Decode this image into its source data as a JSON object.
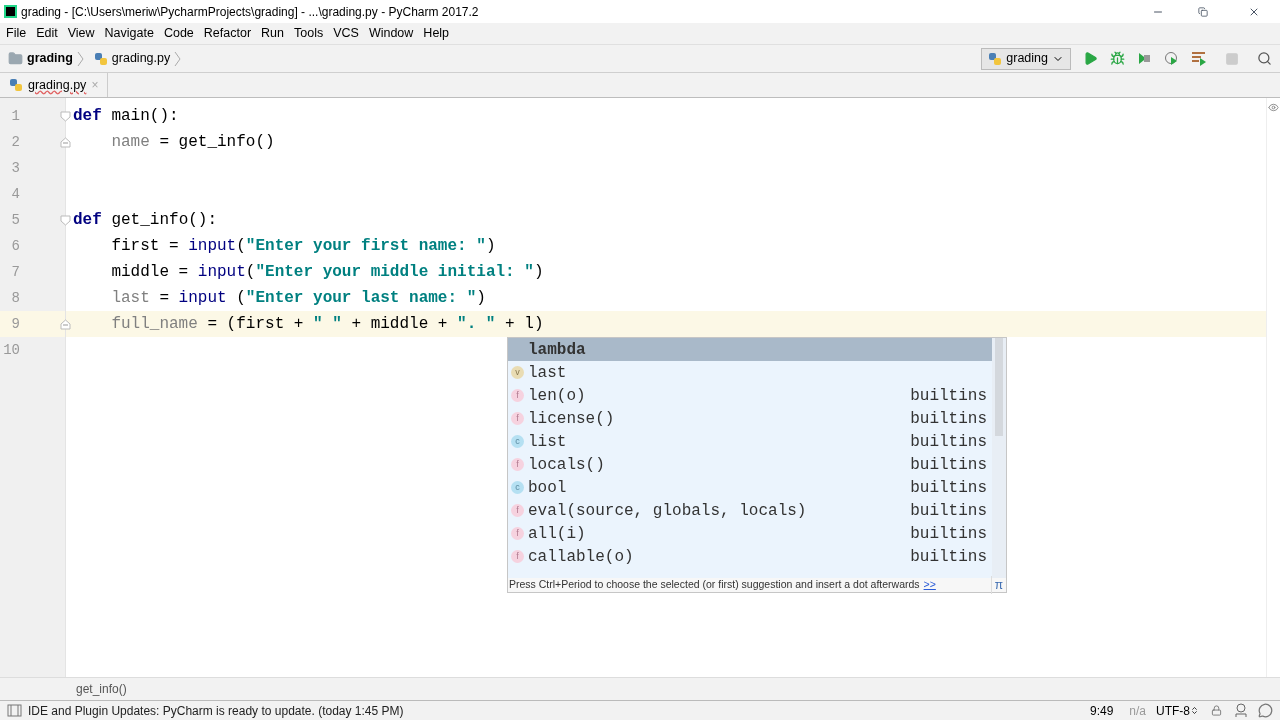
{
  "window": {
    "title": "grading - [C:\\Users\\meriw\\PycharmProjects\\grading] - ...\\grading.py - PyCharm 2017.2"
  },
  "menu": [
    "File",
    "Edit",
    "View",
    "Navigate",
    "Code",
    "Refactor",
    "Run",
    "Tools",
    "VCS",
    "Window",
    "Help"
  ],
  "breadcrumbs": [
    {
      "label": "grading",
      "kind": "folder"
    },
    {
      "label": "grading.py",
      "kind": "file"
    }
  ],
  "run_config": {
    "label": "grading"
  },
  "tabs": [
    {
      "label": "grading.py",
      "selected": true,
      "close": "×"
    }
  ],
  "editor": {
    "lines": [
      {
        "number": "1",
        "fold_start": true,
        "fold_end": false,
        "indent": false,
        "current": false,
        "tokens": [
          {
            "kind": "kw",
            "text": "def"
          },
          {
            "kind": "plain",
            "text": " main():"
          }
        ]
      },
      {
        "number": "2",
        "fold_start": false,
        "fold_end": true,
        "indent": true,
        "current": false,
        "tokens": [
          {
            "kind": "var",
            "text": "name"
          },
          {
            "kind": "plain",
            "text": " = get_info()"
          }
        ]
      },
      {
        "number": "3",
        "fold_start": false,
        "fold_end": false,
        "indent": false,
        "current": false
      },
      {
        "number": "4",
        "fold_start": false,
        "fold_end": false,
        "indent": false,
        "current": false
      },
      {
        "number": "5",
        "fold_start": true,
        "fold_end": false,
        "indent": false,
        "current": false,
        "tokens": [
          {
            "kind": "kw",
            "text": "def"
          },
          {
            "kind": "plain",
            "text": " get_info():"
          }
        ]
      },
      {
        "number": "6",
        "fold_start": false,
        "fold_end": false,
        "indent": true,
        "current": false,
        "tokens": [
          {
            "kind": "plain",
            "text": "first = "
          },
          {
            "kind": "builtin",
            "text": "input"
          },
          {
            "kind": "plain",
            "text": "("
          },
          {
            "kind": "str",
            "text": "\"Enter your first name: \""
          },
          {
            "kind": "plain",
            "text": ")"
          }
        ]
      },
      {
        "number": "7",
        "fold_start": false,
        "fold_end": false,
        "indent": true,
        "current": false,
        "tokens": [
          {
            "kind": "plain",
            "text": "middle = "
          },
          {
            "kind": "builtin",
            "text": "input"
          },
          {
            "kind": "plain",
            "text": "("
          },
          {
            "kind": "str",
            "text": "\"Enter your middle initial: \""
          },
          {
            "kind": "plain",
            "text": ")"
          }
        ]
      },
      {
        "number": "8",
        "fold_start": false,
        "fold_end": false,
        "indent": true,
        "current": false,
        "tokens": [
          {
            "kind": "var",
            "text": "last"
          },
          {
            "kind": "plain",
            "text": " = "
          },
          {
            "kind": "builtin",
            "text": "input"
          },
          {
            "kind": "plain",
            "text": " ("
          },
          {
            "kind": "str",
            "text": "\"Enter your last name: \""
          },
          {
            "kind": "plain",
            "text": ")"
          }
        ]
      },
      {
        "number": "9",
        "fold_start": false,
        "fold_end": true,
        "indent": true,
        "current": true,
        "tokens": [
          {
            "kind": "var",
            "text": "full_name"
          },
          {
            "kind": "plain",
            "text": " = (first + "
          },
          {
            "kind": "str",
            "text": "\" \""
          },
          {
            "kind": "plain",
            "text": " + middle + "
          },
          {
            "kind": "str",
            "text": "\". \""
          },
          {
            "kind": "plain",
            "text": " + l)"
          }
        ]
      },
      {
        "number": "10",
        "fold_start": false,
        "fold_end": false,
        "indent": false,
        "current": false
      }
    ],
    "completion": {
      "items": [
        {
          "kind": "keyword",
          "name": "lambda",
          "selected": true
        },
        {
          "kind": "variable",
          "badge": "v",
          "name": "last",
          "selected": false
        },
        {
          "kind": "function",
          "badge": "f",
          "name": "len(o)",
          "source": "builtins",
          "selected": false
        },
        {
          "kind": "function",
          "badge": "f",
          "name": "license()",
          "source": "builtins",
          "selected": false
        },
        {
          "kind": "class",
          "badge": "c",
          "name": "list",
          "source": "builtins",
          "selected": false
        },
        {
          "kind": "function",
          "badge": "f",
          "name": "locals()",
          "source": "builtins",
          "selected": false
        },
        {
          "kind": "class",
          "badge": "c",
          "name": "bool",
          "source": "builtins",
          "selected": false
        },
        {
          "kind": "function",
          "badge": "f",
          "name": "eval(source, globals, locals)",
          "source": "builtins",
          "selected": false
        },
        {
          "kind": "function",
          "badge": "f",
          "name": "all(i)",
          "source": "builtins",
          "selected": false
        },
        {
          "kind": "function",
          "badge": "f",
          "name": "callable(o)",
          "source": "builtins",
          "selected": false
        }
      ],
      "hint": "Press Ctrl+Period to choose the selected (or first) suggestion and insert a dot afterwards",
      "hint_link": ">>",
      "corner": "π"
    },
    "breadcrumb": "get_info()"
  },
  "status_bar": {
    "message": "IDE and Plugin Updates: PyCharm is ready to update. (today 1:45 PM)",
    "position": "9:49",
    "line_separator": "n/a",
    "encoding": "UTF-8"
  }
}
